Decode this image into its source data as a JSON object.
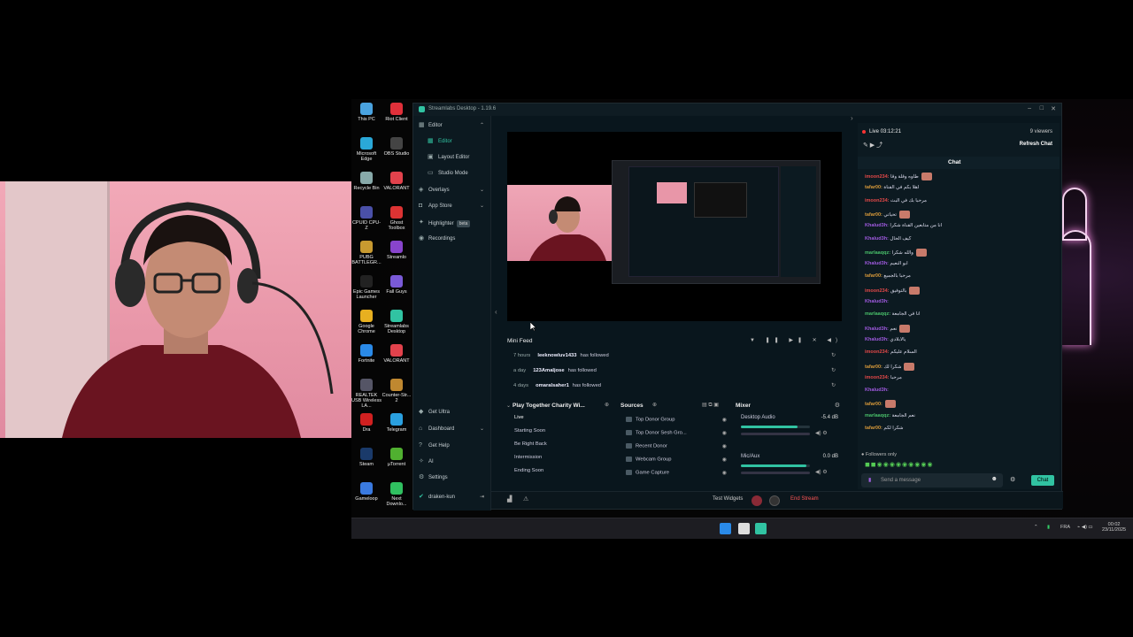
{
  "desktop": {
    "icons": [
      {
        "label": "This PC",
        "color": "#4aa3e0"
      },
      {
        "label": "Riot Client",
        "color": "#e0303a"
      },
      {
        "label": "Microsoft Edge",
        "color": "#2aa8d8"
      },
      {
        "label": "OBS Studio",
        "color": "#444"
      },
      {
        "label": "Recycle Bin",
        "color": "#8aa"
      },
      {
        "label": "VALORANT",
        "color": "#e2424c"
      },
      {
        "label": "CPUID CPU-Z",
        "color": "#4a50a8"
      },
      {
        "label": "Ghost Toolbox",
        "color": "#d33"
      },
      {
        "label": "PUBG BATTLEGR...",
        "color": "#c89a30"
      },
      {
        "label": "Streamlo",
        "color": "#8844cc"
      },
      {
        "label": "Epic Games Launcher",
        "color": "#222"
      },
      {
        "label": "Fall Guys",
        "color": "#7a5ad8"
      },
      {
        "label": "Google Chrome",
        "color": "#e8b020"
      },
      {
        "label": "Streamlabs Desktop",
        "color": "#31c3a2"
      },
      {
        "label": "Fortnite",
        "color": "#2a8ae8"
      },
      {
        "label": "VALORANT",
        "color": "#e2424c"
      },
      {
        "label": "REALTEK USB Wireless LA...",
        "color": "#556"
      },
      {
        "label": "Counter-Str... 2",
        "color": "#c08830"
      },
      {
        "label": "Dra",
        "color": "#d02020"
      },
      {
        "label": "Telegram",
        "color": "#2aa0e0"
      },
      {
        "label": "Steam",
        "color": "#1a3a6a"
      },
      {
        "label": "µTorrent",
        "color": "#50b030"
      },
      {
        "label": "Gameloop",
        "color": "#3a7ae0"
      },
      {
        "label": "Next Downlo...",
        "color": "#30c060"
      }
    ]
  },
  "taskbar": {
    "lang": "FRA",
    "time": "00:02",
    "date": "23/11/2025"
  },
  "app": {
    "title": "Streamlabs Desktop - 1.19.6"
  },
  "nav": {
    "editor": "Editor",
    "editor_sub": "Editor",
    "layout_editor": "Layout Editor",
    "studio_mode": "Studio Mode",
    "overlays": "Overlays",
    "app_store": "App Store",
    "highlighter": "Highlighter",
    "beta": "beta",
    "recordings": "Recordings",
    "get_ultra": "Get Ultra",
    "dashboard": "Dashboard",
    "get_help": "Get Help",
    "ai": "AI",
    "settings": "Settings",
    "user": "draken-kun"
  },
  "minifeed": {
    "title": "Mini Feed",
    "rows": [
      {
        "time": "7 hours",
        "user": "leeknowluv1433",
        "action": "has followed"
      },
      {
        "time": "a day",
        "user": "123Amaljose",
        "action": "has followed"
      },
      {
        "time": "4 days",
        "user": "omaralsaher1",
        "action": "has followed"
      }
    ]
  },
  "scenes": {
    "title": "Play Together Charity Wi...",
    "items": [
      "Live",
      "Starting Soon",
      "Be Right Back",
      "Intermission",
      "Ending Soon"
    ]
  },
  "sources": {
    "title": "Sources",
    "items": [
      "Top Donor Group",
      "Top Donor Sesh Gro...",
      "Recent Donor",
      "Webcam Group",
      "Game Capture"
    ]
  },
  "mixer": {
    "title": "Mixer",
    "channels": [
      {
        "name": "Desktop Audio",
        "db": "-5.4 dB",
        "level": 0.82
      },
      {
        "name": "Mic/Aux",
        "db": "0.0 dB",
        "level": 0.95
      }
    ]
  },
  "bottombar": {
    "test_widgets": "Test Widgets",
    "end_stream": "End Stream"
  },
  "chat": {
    "live_time": "Live 03:12:21",
    "viewers": "9 viewers",
    "refresh": "Refresh Chat",
    "title": "Chat",
    "followers_only": "Followers only",
    "input_placeholder": "Send a message",
    "send": "Chat",
    "messages": [
      {
        "user": "imoon234:",
        "text": "طاوه وقلة وقا",
        "color": "#e24848"
      },
      {
        "user": "tafar00:",
        "text": "اهلا بكم في القناة",
        "color": "#d89a3a"
      },
      {
        "user": "imoon234:",
        "text": "مرحبا بك في البث",
        "color": "#e24848"
      },
      {
        "user": "tafar00:",
        "text": "تحياتي",
        "color": "#d89a3a"
      },
      {
        "user": "Khalud3h:",
        "text": "انا من متابعين القناة شكرا",
        "color": "#a05ae0"
      },
      {
        "user": "Khalud3h:",
        "text": "كيف الحال",
        "color": "#a05ae0"
      },
      {
        "user": "marlaaqqz:",
        "text": "والله شكرا",
        "color": "#49c06a"
      },
      {
        "user": "Khalud3h:",
        "text": "ابو النعيم",
        "color": "#a05ae0"
      },
      {
        "user": "tafar00:",
        "text": "مرحبا بالجميع",
        "color": "#d89a3a"
      },
      {
        "user": "imoon234:",
        "text": "بالتوفيق",
        "color": "#e24848"
      },
      {
        "user": "Khalud3h:",
        "text": "",
        "color": "#a05ae0"
      },
      {
        "user": "marlaaqqz:",
        "text": "انا في الجامعة",
        "color": "#49c06a"
      },
      {
        "user": "Khalud3h:",
        "text": "نعم",
        "color": "#a05ae0"
      },
      {
        "user": "Khalud3h:",
        "text": "يالابلادي",
        "color": "#a05ae0"
      },
      {
        "user": "imoon234:",
        "text": "السلام عليكم",
        "color": "#e24848"
      },
      {
        "user": "tafar00:",
        "text": "شكرا لك",
        "color": "#d89a3a"
      },
      {
        "user": "imoon234:",
        "text": "مرحبا",
        "color": "#e24848"
      },
      {
        "user": "Khalud3h:",
        "text": "",
        "color": "#a05ae0"
      },
      {
        "user": "tafar00:",
        "text": "",
        "color": "#d89a3a"
      },
      {
        "user": "marlaaqqz:",
        "text": "نعم الجامعة",
        "color": "#49c06a"
      },
      {
        "user": "tafar00:",
        "text": "شكرا لكم",
        "color": "#d89a3a"
      }
    ]
  },
  "colors": {
    "accent": "#31c3a2",
    "danger": "#e24848"
  }
}
